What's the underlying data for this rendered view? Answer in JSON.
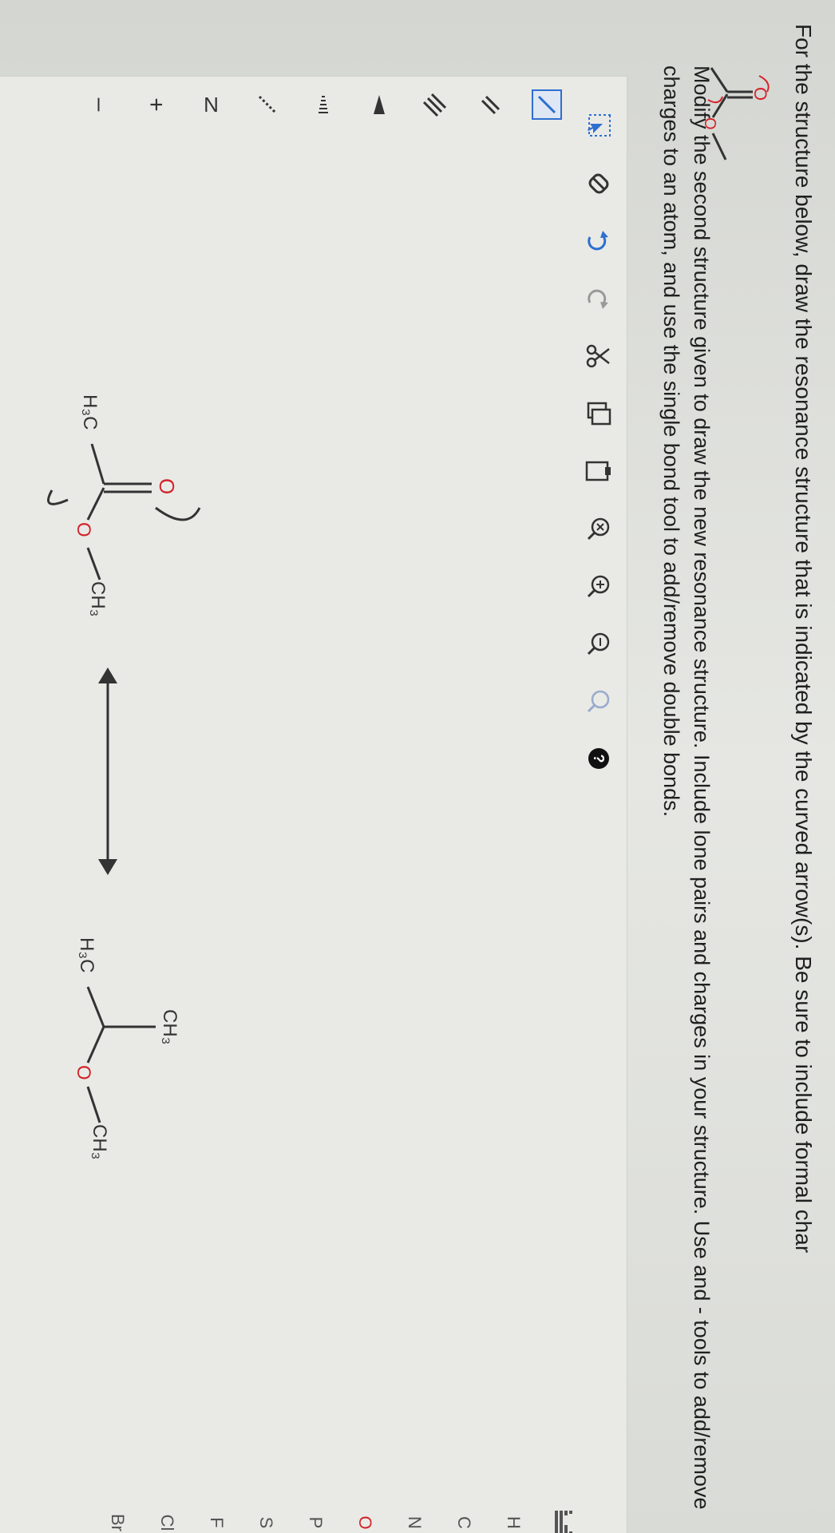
{
  "question": {
    "line1": "For the structure below, draw the resonance structure that is indicated by the curved arrow(s). Be sure to include formal char",
    "line2": "Modify the second structure given to draw the new resonance structure. Include lone pairs and charges in your structure. Use and - tools to add/remove charges to an atom, and use the single bond tool to add/remove double bonds."
  },
  "example_molecule": {
    "carbonyl_o": "O",
    "ester_o": "O"
  },
  "toolbar": {
    "icons": [
      "select-icon",
      "eraser-icon",
      "undo-icon",
      "redo-icon",
      "cut-icon",
      "copy-icon",
      "paste-icon",
      "zoom-reset-icon",
      "zoom-in-icon",
      "zoom-out-icon",
      "structure-icon",
      "help-icon"
    ]
  },
  "left_tools": [
    "single-bond-tool",
    "double-bond-tool",
    "triple-bond-tool",
    "wedge-bond-tool",
    "hash-bond-tool",
    "dashed-bond-tool",
    "chain-tool",
    "plus-charge-tool",
    "minus-charge-tool"
  ],
  "left_tool_labels": {
    "chain": "N",
    "plus": "+",
    "minus": "–"
  },
  "periodic": {
    "table_icon": "periodic-table-icon",
    "elements": [
      "H",
      "C",
      "N",
      "O",
      "P",
      "S",
      "F",
      "Cl"
    ],
    "partial_next": "Br"
  },
  "structure1": {
    "h3c": "H₃C",
    "o_top": "O",
    "o_ester": "O",
    "ch3": "CH₃"
  },
  "structure2": {
    "h3c": "H₃C",
    "ch3_top": "CH₃",
    "o_ester": "O",
    "ch3": "CH₃"
  },
  "colors": {
    "red": "#d2232a",
    "blue": "#2e6fd0",
    "text": "#1f1f1f",
    "tool": "#555555"
  }
}
